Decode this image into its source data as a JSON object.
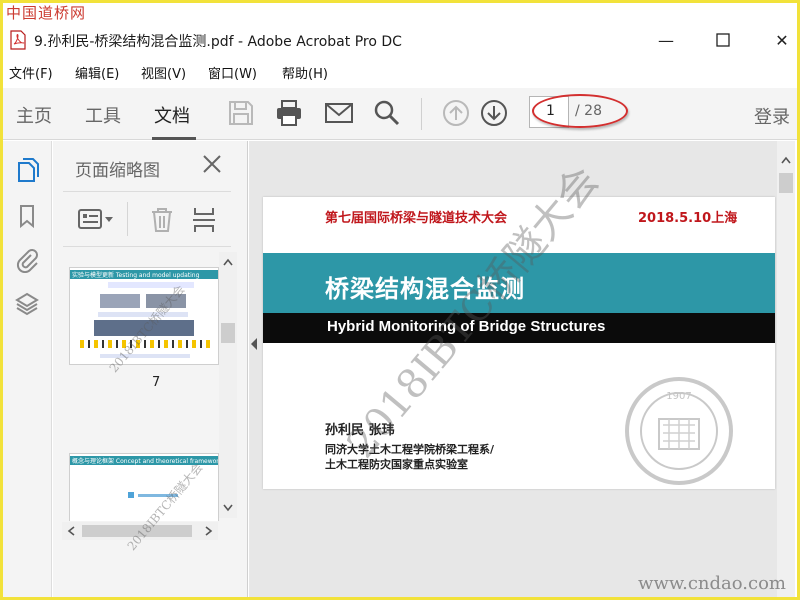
{
  "watermarks": {
    "top_left": "中国道桥网",
    "bottom_right": "www.cndao.com",
    "diagonal": "2018IBTC桥隧大会"
  },
  "window": {
    "title": "9.孙利民-桥梁结构混合监测.pdf - Adobe Acrobat Pro DC",
    "minimize_glyph": "—",
    "maximize_glyph": "☐",
    "close_glyph": "✕"
  },
  "menu": [
    "文件(F)",
    "编辑(E)",
    "视图(V)",
    "窗口(W)",
    "帮助(H)"
  ],
  "toolbar": {
    "tabs": [
      {
        "label": "主页",
        "active": false
      },
      {
        "label": "工具",
        "active": false
      },
      {
        "label": "文档",
        "active": true
      }
    ],
    "icons": [
      "save-icon",
      "print-icon",
      "email-icon",
      "search-icon",
      "page-up-icon",
      "page-down-icon"
    ],
    "current_page": "1",
    "total_pages": "/ 28",
    "login": "登录"
  },
  "sidebar": {
    "icons": [
      "page-thumbnails-icon",
      "bookmark-icon",
      "attachment-icon",
      "layers-icon"
    ]
  },
  "thumbnail_panel": {
    "title": "页面缩略图",
    "thumbnails": [
      {
        "page_label": "7",
        "header": "实验与模型更新 Testing and model updating"
      },
      {
        "page_label": "",
        "header": "概念与理论框架 Concept and theoretical framework"
      }
    ]
  },
  "document_page": {
    "conference": "第七届国际桥梁与隧道技术大会",
    "date": "2018.5.10上海",
    "title_cn": "桥梁结构混合监测",
    "title_en": "Hybrid Monitoring of Bridge Structures",
    "authors": "孙利民 张玮",
    "affiliation_1": "同济大学土木工程学院桥梁工程系/",
    "affiliation_2": "土木工程防灾国家重点实验室",
    "seal_year": "1907"
  },
  "colors": {
    "accent_red": "#c0171c",
    "banner_teal": "#2d97a7",
    "frame_yellow": "#f2e23a"
  }
}
